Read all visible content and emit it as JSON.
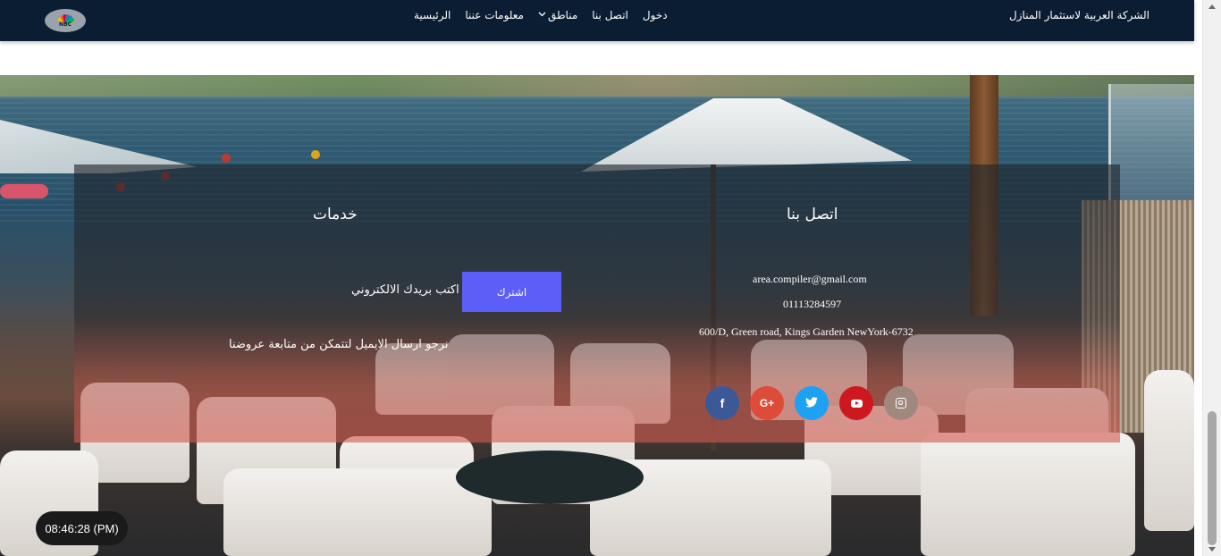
{
  "navbar": {
    "brand": "الشركة العربية لاستثمار المنازل",
    "logo_text": "NBC",
    "links": [
      {
        "label": "الرئيسية"
      },
      {
        "label": "معلومات عننا"
      },
      {
        "label": "مناطق",
        "has_dropdown": true
      },
      {
        "label": "اتصل بنا"
      },
      {
        "label": "دخول"
      }
    ],
    "background_color": "#0a1d33"
  },
  "footer": {
    "contact": {
      "title": "اتصل بنا",
      "email": "area.compiler@gmail.com",
      "phone": "01113284597",
      "address": "600/D, Green road, Kings Garden NewYork-6732"
    },
    "services": {
      "title": "خدمات",
      "subscribe_button": "اشترك",
      "email_prompt": "اكتب بريدك الالكتروني",
      "note": "نرجو ارسال الايميل لتتمكن من متابعة عروضنا"
    },
    "social": [
      {
        "name": "facebook",
        "icon": "facebook-icon",
        "glyph": "f",
        "color": "#3b5998"
      },
      {
        "name": "google-plus",
        "icon": "google-plus-icon",
        "glyph": "G+",
        "color": "#dd4b39"
      },
      {
        "name": "twitter",
        "icon": "twitter-icon",
        "glyph": "🐦",
        "color": "#1da1f2"
      },
      {
        "name": "youtube",
        "icon": "youtube-icon",
        "glyph": "",
        "color": "#cc181e"
      },
      {
        "name": "instagram",
        "icon": "instagram-icon",
        "glyph": "",
        "color": "#a1887f"
      }
    ],
    "accent_color": "#5b5ff7"
  },
  "clock": {
    "time": "08:46:28 (PM)"
  }
}
